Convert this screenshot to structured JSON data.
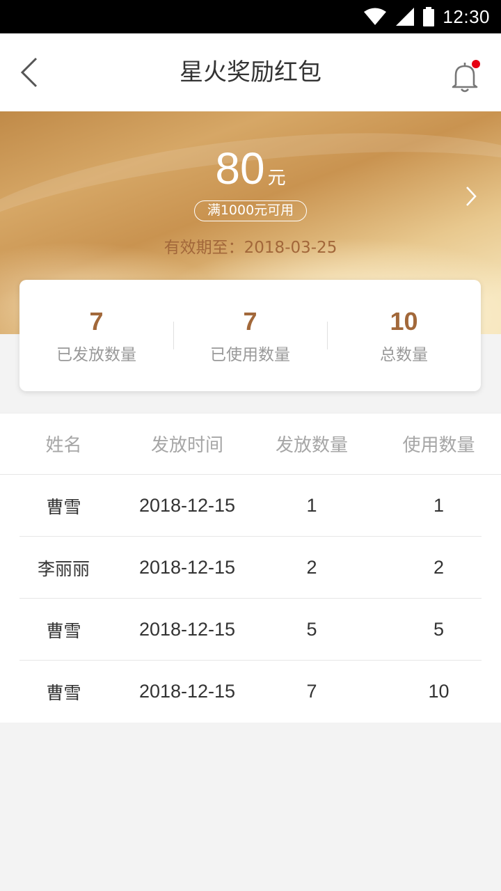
{
  "status_bar": {
    "time": "12:30",
    "icons": [
      "wifi-icon",
      "signal-icon",
      "battery-icon"
    ]
  },
  "header": {
    "title": "星火奖励红包",
    "back_icon": "chevron-left-icon",
    "notification_icon": "bell-icon",
    "has_unread_dot": true
  },
  "banner": {
    "amount": "80",
    "unit": "元",
    "condition": "满1000元可用",
    "validity": "有效期至：2018-03-25",
    "arrow_icon": "chevron-right-icon"
  },
  "stats": [
    {
      "value": "7",
      "label": "已发放数量"
    },
    {
      "value": "7",
      "label": "已使用数量"
    },
    {
      "value": "10",
      "label": "总数量"
    }
  ],
  "table": {
    "headers": [
      "姓名",
      "发放时间",
      "发放数量",
      "使用数量"
    ],
    "rows": [
      {
        "name": "曹雪",
        "date": "2018-12-15",
        "issued": "1",
        "used": "1"
      },
      {
        "name": "李丽丽",
        "date": "2018-12-15",
        "issued": "2",
        "used": "2"
      },
      {
        "name": "曹雪",
        "date": "2018-12-15",
        "issued": "5",
        "used": "5"
      },
      {
        "name": "曹雪",
        "date": "2018-12-15",
        "issued": "7",
        "used": "10"
      }
    ]
  },
  "colors": {
    "accent_brown": "#a2683a",
    "notification_dot": "#e60012",
    "page_background": "#f3f3f3"
  }
}
